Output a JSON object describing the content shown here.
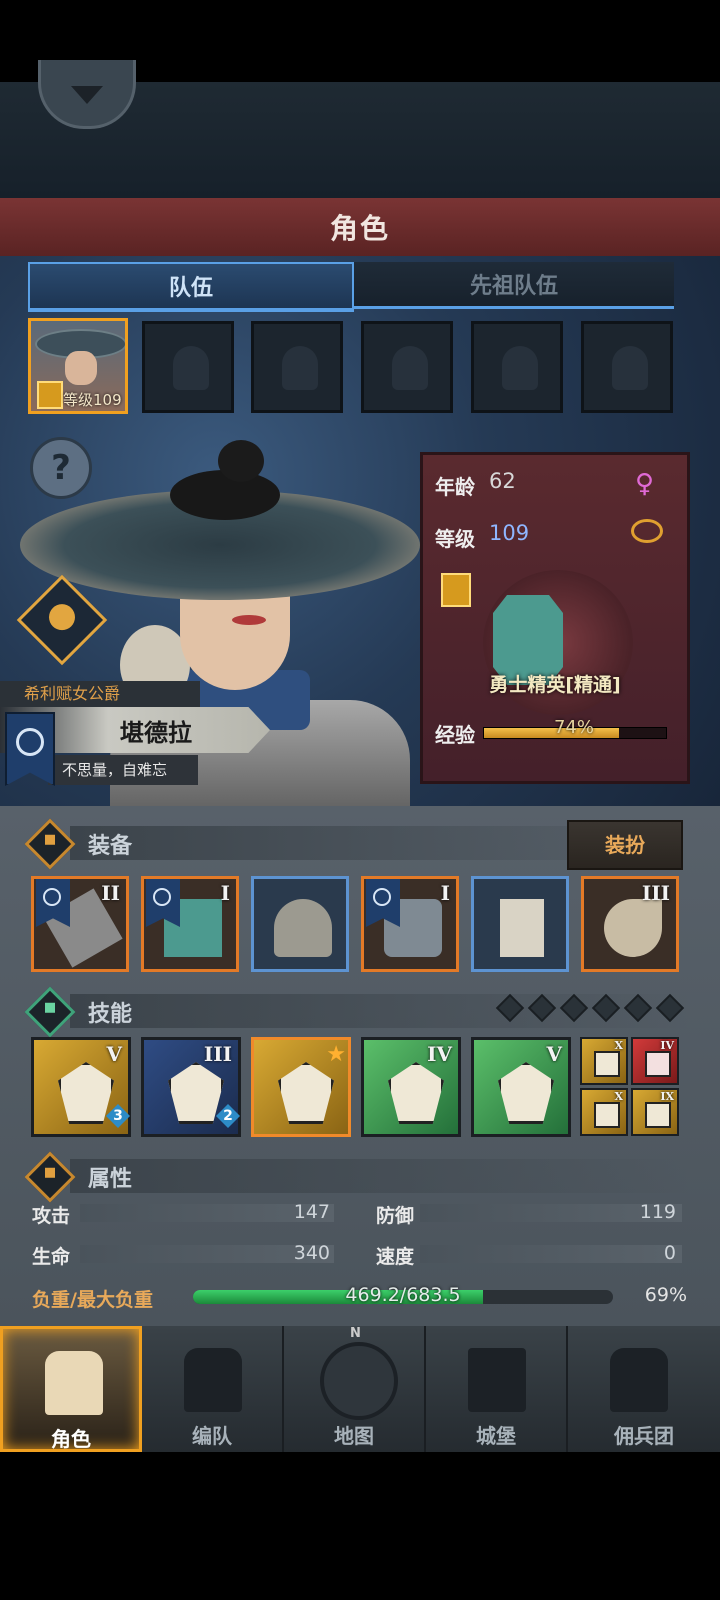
{
  "header": {
    "title": "角色"
  },
  "tabs": [
    {
      "label": "队伍",
      "active": true
    },
    {
      "label": "先祖队伍",
      "active": false
    }
  ],
  "party": {
    "hero_level_label": "等级109",
    "empty_slots": 5
  },
  "hero": {
    "title": "希利赋女公爵",
    "name": "堪德拉",
    "motto": "不思量，自难忘"
  },
  "stats_card": {
    "age_label": "年龄",
    "age": "62",
    "level_label": "等级",
    "level": "109",
    "class_name": "勇士精英[精通]",
    "xp_label": "经验",
    "xp_text": "74%",
    "xp_fraction": 0.74,
    "gender_icon": "female-icon",
    "ring_icon": "ring-icon"
  },
  "equipment": {
    "title": "装备",
    "dress_button": "装扮",
    "items": [
      {
        "name": "weapon",
        "rank": "II",
        "rarity": "orange",
        "has_flag": true
      },
      {
        "name": "shield",
        "rank": "I",
        "rarity": "orange",
        "has_flag": true
      },
      {
        "name": "helmet",
        "rank": "",
        "rarity": "blue",
        "has_flag": false
      },
      {
        "name": "armor",
        "rank": "I",
        "rarity": "orange",
        "has_flag": true
      },
      {
        "name": "boots",
        "rank": "",
        "rarity": "blue",
        "has_flag": false
      },
      {
        "name": "horn",
        "rank": "III",
        "rarity": "orange",
        "has_flag": false
      }
    ]
  },
  "skills": {
    "title": "技能",
    "pips": 6,
    "items": [
      {
        "name": "shield-sword-skill",
        "rank": "V",
        "level": "3",
        "style": "gold"
      },
      {
        "name": "shield-bash-skill",
        "rank": "III",
        "level": "2",
        "style": "navy"
      },
      {
        "name": "charge-skill",
        "rank": "",
        "level": "",
        "style": "orange"
      },
      {
        "name": "crystal-burst-skill",
        "rank": "IV",
        "level": "",
        "style": "green"
      },
      {
        "name": "crystal-skill",
        "rank": "V",
        "level": "",
        "style": "green"
      }
    ],
    "passives": [
      {
        "name": "passive-shield",
        "rank": "X",
        "style": "gold"
      },
      {
        "name": "passive-heart",
        "rank": "IV",
        "style": "red"
      },
      {
        "name": "passive-guard",
        "rank": "X",
        "style": "gold"
      },
      {
        "name": "passive-block",
        "rank": "IX",
        "style": "gold"
      }
    ]
  },
  "attributes": {
    "title": "属性",
    "attack_label": "攻击",
    "attack": "147",
    "defense_label": "防御",
    "defense": "119",
    "hp_label": "生命",
    "hp": "340",
    "speed_label": "速度",
    "speed": "0",
    "load_label": "负重/最大负重",
    "load_text": "469.2/683.5",
    "load_pct": "69%",
    "load_fraction": 0.69
  },
  "nav": [
    {
      "label": "角色",
      "active": true
    },
    {
      "label": "编队",
      "active": false
    },
    {
      "label": "地图",
      "active": false,
      "compass": "N"
    },
    {
      "label": "城堡",
      "active": false
    },
    {
      "label": "佣兵团",
      "active": false
    }
  ],
  "colors": {
    "accent_gold": "#f0a020",
    "rarity_orange": "#e37a27",
    "rarity_blue": "#5d93d1",
    "xp_gold": "#f4c04a",
    "load_green": "#3cd06a",
    "title_red": "#7a3434"
  }
}
